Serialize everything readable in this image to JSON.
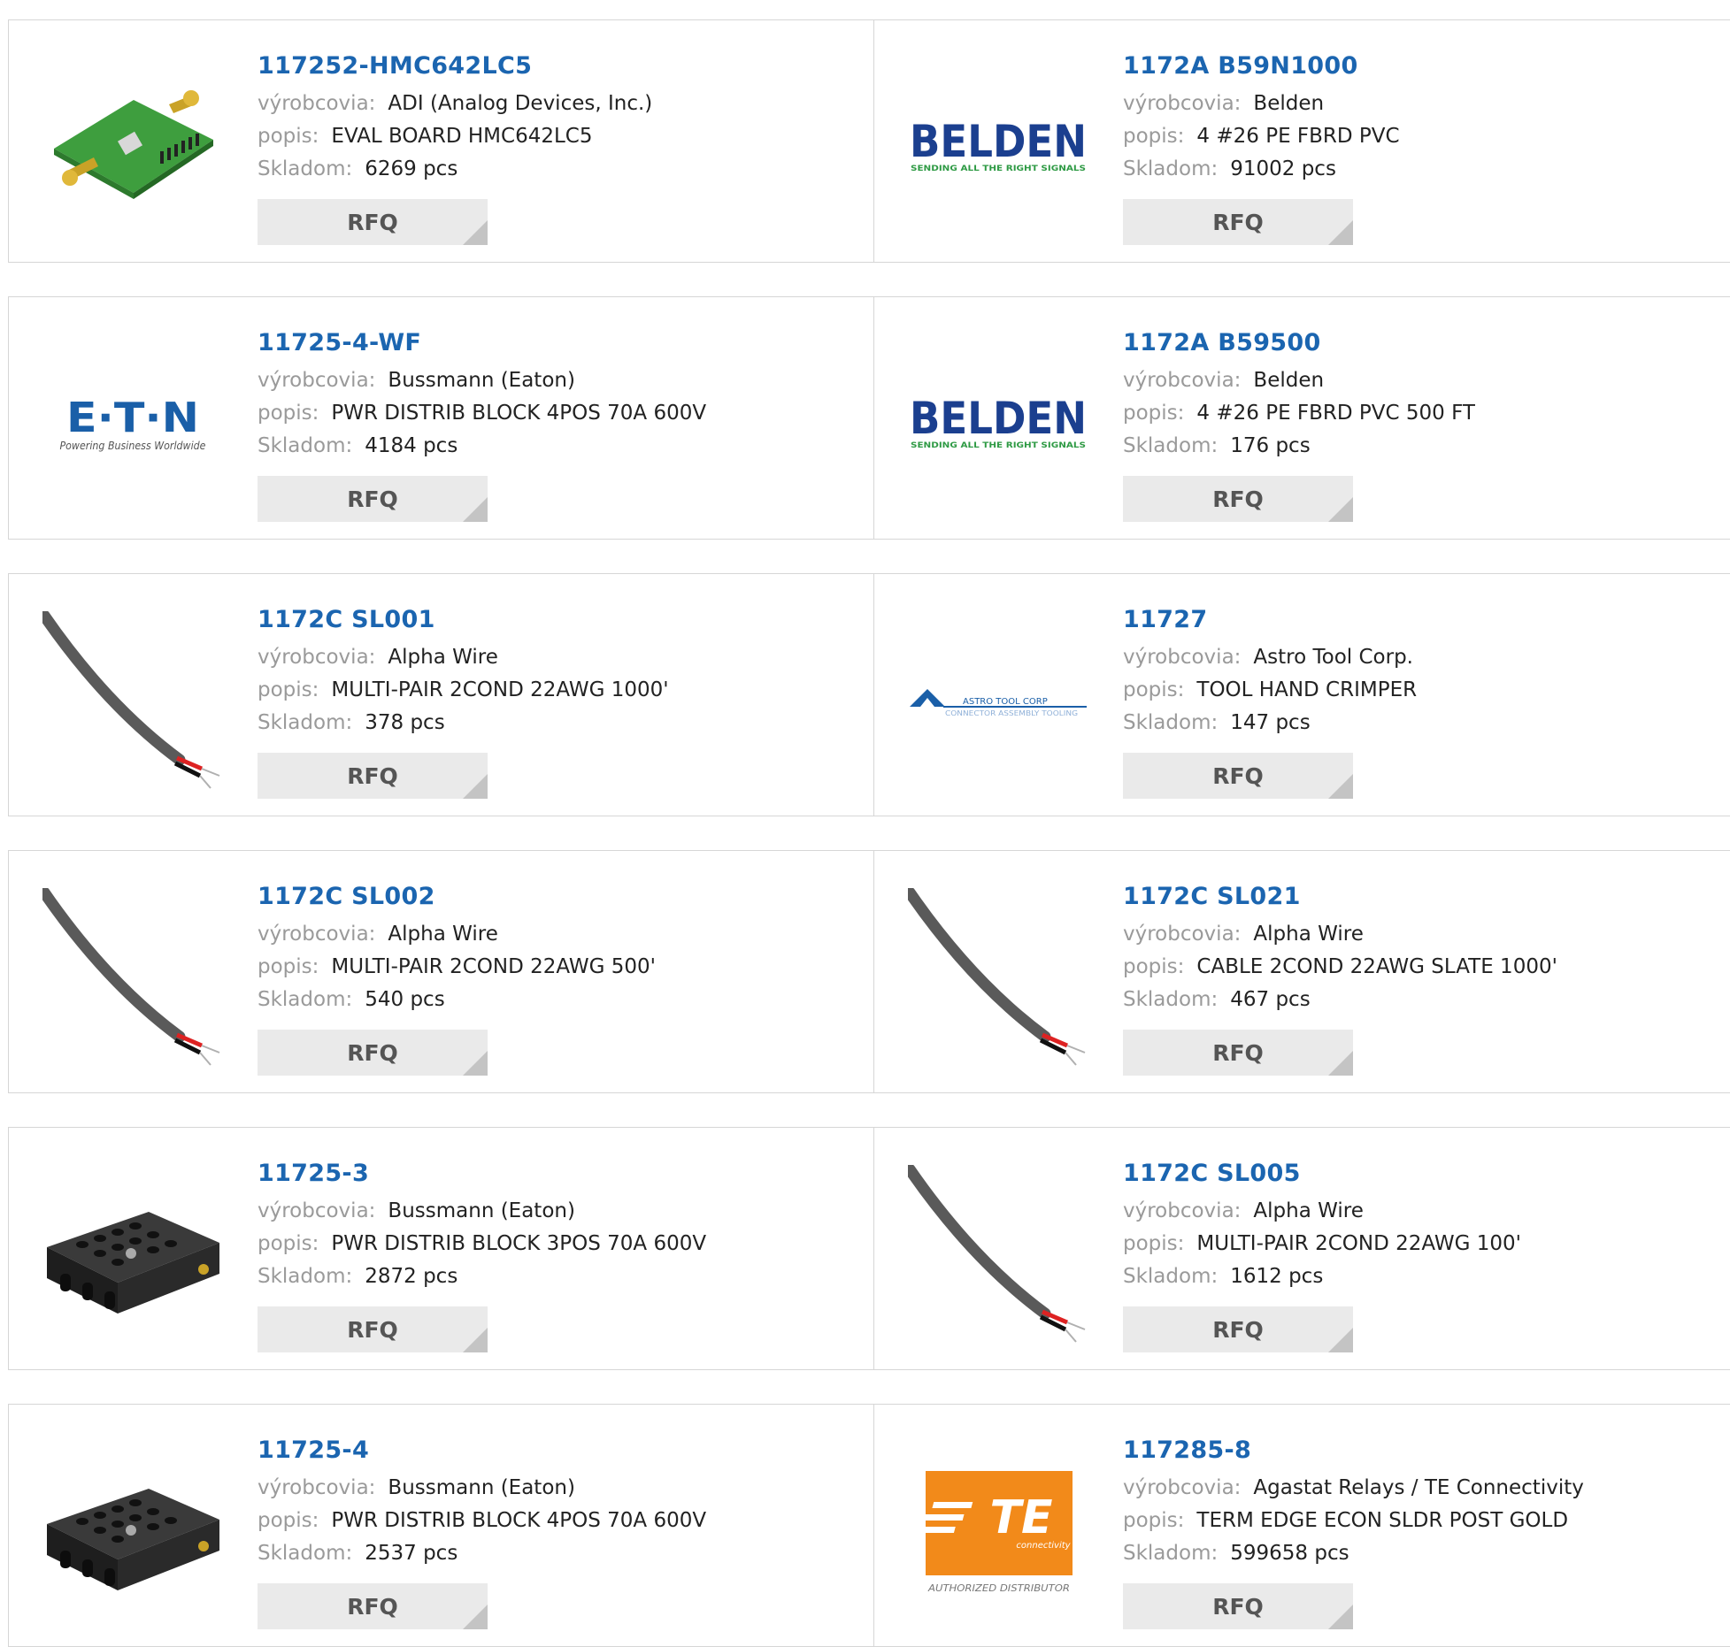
{
  "labels": {
    "manufacturer": "výrobcovia:",
    "description": "popis:",
    "stock": "Skladom:",
    "rfq": "RFQ"
  },
  "products": [
    {
      "part": "117252-HMC642LC5",
      "manufacturer": "ADI (Analog Devices, Inc.)",
      "description": "EVAL BOARD HMC642LC5",
      "stock": "6269 pcs",
      "image": "eval-board-image"
    },
    {
      "part": "1172A B59N1000",
      "manufacturer": "Belden",
      "description": "4 #26 PE FBRD PVC",
      "stock": "91002 pcs",
      "image": "belden-logo"
    },
    {
      "part": "11725-4-WF",
      "manufacturer": "Bussmann (Eaton)",
      "description": "PWR DISTRIB BLOCK 4POS 70A 600V",
      "stock": "4184 pcs",
      "image": "eaton-logo"
    },
    {
      "part": "1172A B59500",
      "manufacturer": "Belden",
      "description": "4 #26 PE FBRD PVC 500 FT",
      "stock": "176 pcs",
      "image": "belden-logo"
    },
    {
      "part": "1172C SL001",
      "manufacturer": "Alpha Wire",
      "description": "MULTI-PAIR 2COND 22AWG 1000'",
      "stock": "378 pcs",
      "image": "cable-image"
    },
    {
      "part": "11727",
      "manufacturer": "Astro Tool Corp.",
      "description": "TOOL HAND CRIMPER",
      "stock": "147 pcs",
      "image": "astro-tool-logo"
    },
    {
      "part": "1172C SL002",
      "manufacturer": "Alpha Wire",
      "description": "MULTI-PAIR 2COND 22AWG 500'",
      "stock": "540 pcs",
      "image": "cable-image"
    },
    {
      "part": "1172C SL021",
      "manufacturer": "Alpha Wire",
      "description": "CABLE 2COND 22AWG SLATE 1000'",
      "stock": "467 pcs",
      "image": "cable-image"
    },
    {
      "part": "11725-3",
      "manufacturer": "Bussmann (Eaton)",
      "description": "PWR DISTRIB BLOCK 3POS 70A 600V",
      "stock": "2872 pcs",
      "image": "terminal-block-image"
    },
    {
      "part": "1172C SL005",
      "manufacturer": "Alpha Wire",
      "description": "MULTI-PAIR 2COND 22AWG 100'",
      "stock": "1612 pcs",
      "image": "cable-image"
    },
    {
      "part": "11725-4",
      "manufacturer": "Bussmann (Eaton)",
      "description": "PWR DISTRIB BLOCK 4POS 70A 600V",
      "stock": "2537 pcs",
      "image": "terminal-block-image"
    },
    {
      "part": "117285-8",
      "manufacturer": "Agastat Relays / TE Connectivity",
      "description": "TERM EDGE ECON SLDR POST GOLD",
      "stock": "599658 pcs",
      "image": "te-logo"
    }
  ],
  "logos": {
    "belden": {
      "name": "BELDEN",
      "tagline": "SENDING ALL THE RIGHT SIGNALS"
    },
    "eaton": {
      "name": "E·T·N",
      "tagline": "Powering Business Worldwide"
    },
    "astro": {
      "name": "ASTRO TOOL CORP",
      "tagline": "CONNECTOR ASSEMBLY TOOLING"
    },
    "te": {
      "name": "TE",
      "tagline": "connectivity",
      "badge": "AUTHORIZED DISTRIBUTOR"
    }
  },
  "colors": {
    "link": "#1b65b0",
    "belden": "#1b3f8f",
    "te_orange": "#f28a1a",
    "eaton": "#1a5fa8"
  }
}
